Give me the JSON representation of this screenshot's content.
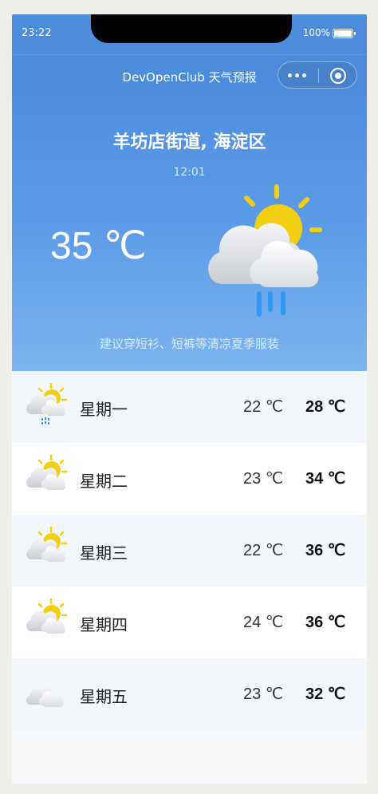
{
  "status_bar": {
    "time": "23:22",
    "battery": "100%"
  },
  "nav": {
    "title": "DevOpenClub 天气预报"
  },
  "current": {
    "location": "羊坊店街道, 海淀区",
    "update_time": "12:01",
    "temperature": "35 ℃",
    "icon": "sun-cloud-rain-icon",
    "suggestion": "建议穿短衫、短裤等清凉夏季服装"
  },
  "forecast": [
    {
      "day": "星期一",
      "low": "22 ℃",
      "high": "28 ℃",
      "icon": "sun-cloud-rain-icon"
    },
    {
      "day": "星期二",
      "low": "23 ℃",
      "high": "34 ℃",
      "icon": "sun-cloud-icon"
    },
    {
      "day": "星期三",
      "low": "22 ℃",
      "high": "36 ℃",
      "icon": "sun-cloud-icon"
    },
    {
      "day": "星期四",
      "low": "24 ℃",
      "high": "36 ℃",
      "icon": "sun-cloud-icon"
    },
    {
      "day": "星期五",
      "low": "23 ℃",
      "high": "32 ℃",
      "icon": "cloud-icon"
    }
  ],
  "colors": {
    "header_blue": "#4d8cdc",
    "sun_yellow": "#f2cf10",
    "rain_blue": "#2e9bf0"
  }
}
